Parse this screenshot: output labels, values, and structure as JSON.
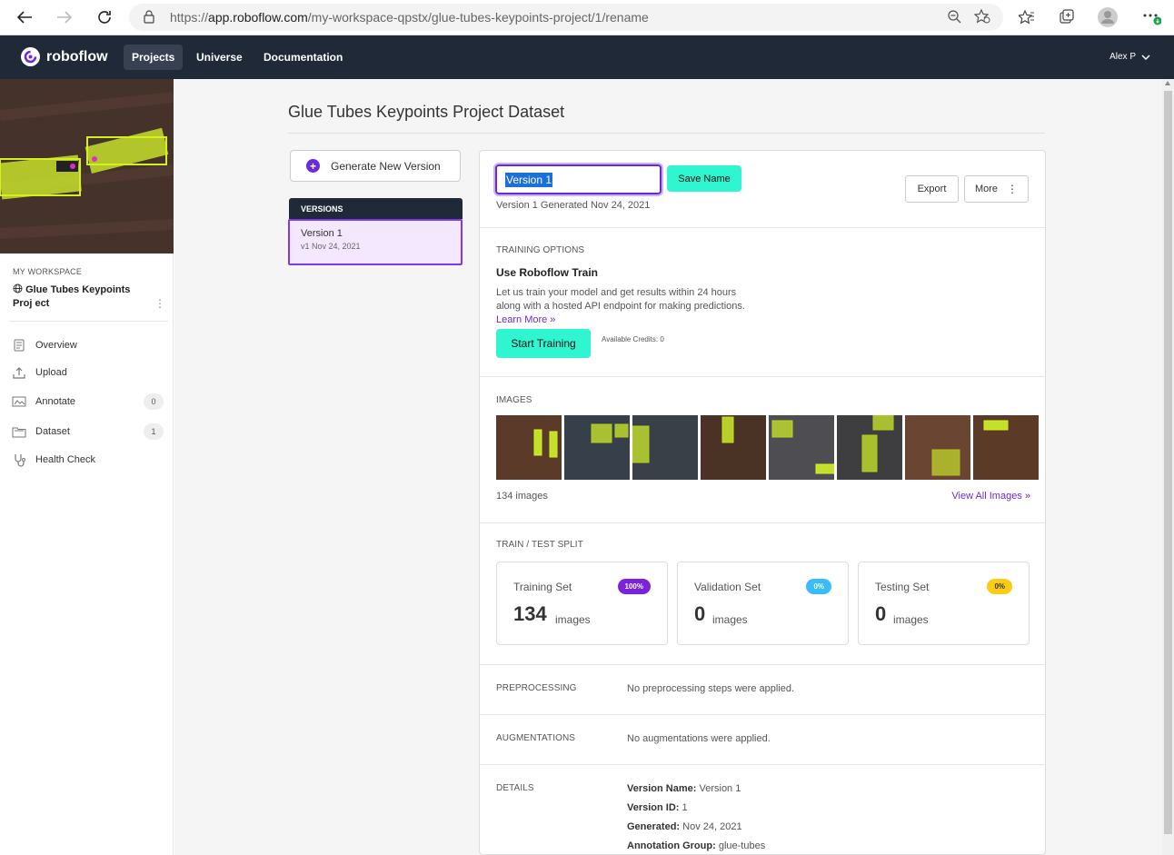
{
  "browser": {
    "url_prefix": "https://",
    "url_domain": "app.roboflow.com",
    "url_path": "/my-workspace-qpstx/glue-tubes-keypoints-project/1/rename"
  },
  "appbar": {
    "brand": "roboflow",
    "nav": [
      "Projects",
      "Universe",
      "Documentation"
    ],
    "user": "Alex P"
  },
  "sidebar": {
    "workspace_label": "MY WORKSPACE",
    "project_name": "Glue Tubes Keypoints Proj ect",
    "items": [
      {
        "label": "Overview",
        "icon": "overview-icon"
      },
      {
        "label": "Upload",
        "icon": "upload-icon"
      },
      {
        "label": "Annotate",
        "icon": "annotate-icon",
        "count": "0"
      },
      {
        "label": "Dataset",
        "icon": "dataset-icon",
        "count": "1"
      },
      {
        "label": "Health Check",
        "icon": "health-check-icon"
      }
    ]
  },
  "main": {
    "title": "Glue Tubes Keypoints Project Dataset",
    "generate_button": "Generate New Version",
    "versions_header": "VERSIONS",
    "version_item": {
      "name": "Version 1",
      "sub": "v1 Nov 24, 2021"
    }
  },
  "panel": {
    "name_input_value": "Version 1",
    "save_button": "Save Name",
    "generated": "Version 1 Generated Nov 24, 2021",
    "export_button": "Export",
    "more_button": "More",
    "training": {
      "label": "TRAINING OPTIONS",
      "title": "Use Roboflow Train",
      "desc": "Let us train your model and get results within 24 hours along with a hosted API endpoint for making predictions.",
      "learn_more": "Learn More »",
      "start_button": "Start Training",
      "credits": "Available Credits: 0"
    },
    "images": {
      "label": "IMAGES",
      "count": "134 images",
      "view_all": "View All Images »"
    },
    "split": {
      "label": "TRAIN / TEST SPLIT",
      "cards": [
        {
          "label": "Training Set",
          "badge": "100%",
          "num": "134",
          "unit": "images",
          "color": "#7c22d9"
        },
        {
          "label": "Validation Set",
          "badge": "0%",
          "num": "0",
          "unit": "images",
          "color": "#38bdf8"
        },
        {
          "label": "Testing Set",
          "badge": "0%",
          "num": "0",
          "unit": "images",
          "color": "#facc15"
        }
      ]
    },
    "preprocessing": {
      "label": "PREPROCESSING",
      "text": "No preprocessing steps were applied."
    },
    "augmentations": {
      "label": "AUGMENTATIONS",
      "text": "No augmentations were applied."
    },
    "details": {
      "label": "DETAILS",
      "rows": [
        {
          "key": "Version Name:",
          "value": "Version 1"
        },
        {
          "key": "Version ID:",
          "value": "1"
        },
        {
          "key": "Generated:",
          "value": "Nov 24, 2021"
        },
        {
          "key": "Annotation Group:",
          "value": "glue-tubes"
        }
      ]
    }
  },
  "colors": {
    "accent": "#6d28d9",
    "teal": "#2ff5d0",
    "dark": "#1f2937"
  }
}
